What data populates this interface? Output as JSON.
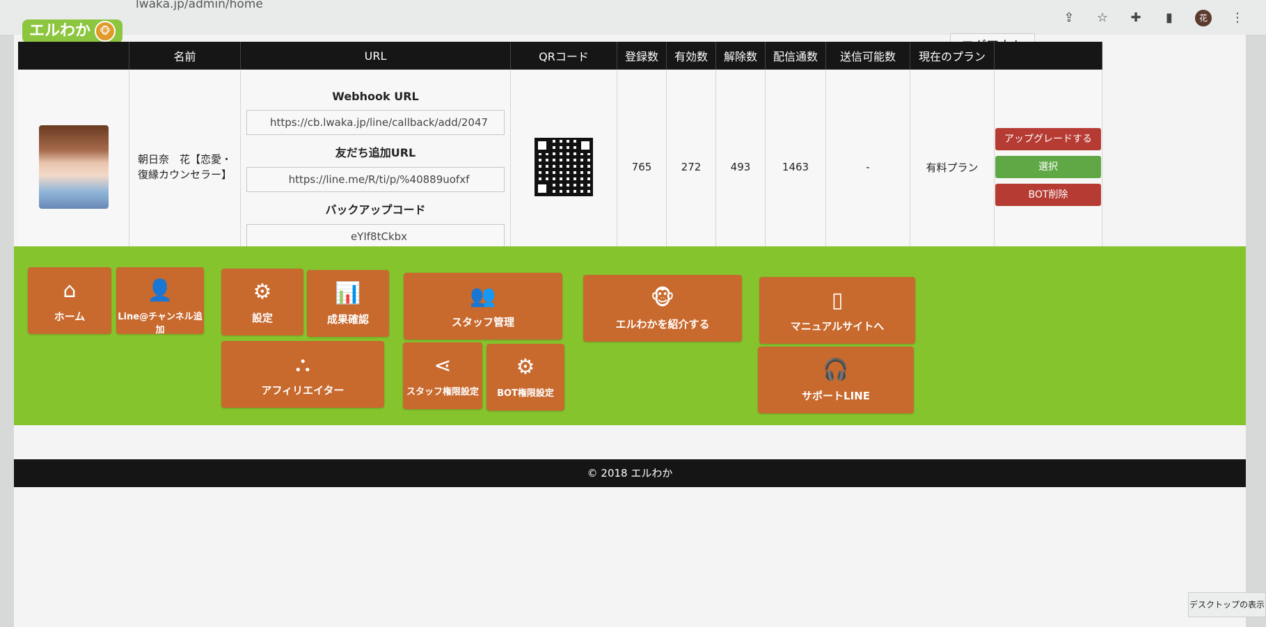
{
  "browser": {
    "url": "lwaka.jp/admin/home",
    "profile_initial": "花"
  },
  "header": {
    "logo_text": "エルわか",
    "logout_label": "ログアウト"
  },
  "table": {
    "columns": [
      "名前",
      "URL",
      "QRコード",
      "登録数",
      "有効数",
      "解除数",
      "配信通数",
      "送信可能数",
      "現在のプラン"
    ],
    "row": {
      "name": "朝日奈　花【恋愛・復縁カウンセラー】",
      "webhook_label": "Webhook URL",
      "webhook_url": "https://cb.lwaka.jp/line/callback/add/2047",
      "friend_label": "友だち追加URL",
      "friend_url": "https://line.me/R/ti/p/%40889uofxf",
      "backup_label": "バックアップコード",
      "backup_code": "eYIf8tCkbx",
      "registered": "765",
      "valid": "272",
      "cancelled": "493",
      "deliveries": "1463",
      "sendable": "-",
      "plan": "有料プラン"
    },
    "actions": {
      "upgrade": "アップグレードする",
      "select": "選択",
      "delete_bot": "BOT削除"
    }
  },
  "menu": {
    "home": "ホーム",
    "add_channel": "Line@チャンネル追加",
    "settings": "設定",
    "results": "成果確認",
    "staff": "スタッフ管理",
    "introduce": "エルわかを紹介する",
    "manual": "マニュアルサイトへ",
    "affiliate": "アフィリエイター",
    "staff_perm": "スタッフ権限設定",
    "bot_perm": "BOT権限設定",
    "support": "サポートLINE"
  },
  "footer": {
    "copyright": "© 2018 エルわか"
  },
  "os": {
    "show_desktop": "デスクトップの表示"
  },
  "colors": {
    "tile": "#c8692d",
    "green_band": "#86c42e",
    "header_dark": "#161616",
    "danger": "#b63b33",
    "success": "#5fa845"
  }
}
